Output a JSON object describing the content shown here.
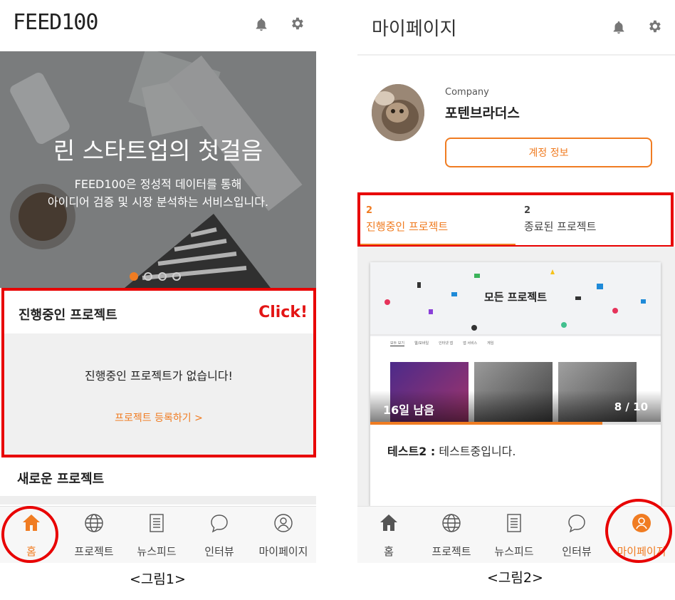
{
  "screen1": {
    "logo": "FEED100",
    "hero": {
      "title": "린 스타트업의 첫걸음",
      "subtitle_line1": "FEED100은 정성적 데이터를 통해",
      "subtitle_line2": "아이디어 검증 및 시장 분석하는 서비스입니다.",
      "slides": 4,
      "active_slide": 1
    },
    "in_progress": {
      "title": "진행중인 프로젝트",
      "annotation": "Click!",
      "empty_message": "진행중인 프로젝트가 없습니다!",
      "register_link": "프로젝트 등록하기 >"
    },
    "new_projects_title": "새로운 프로젝트",
    "nav": [
      {
        "label": "홈",
        "icon": "home-icon",
        "active": true
      },
      {
        "label": "프로젝트",
        "icon": "globe-icon",
        "active": false
      },
      {
        "label": "뉴스피드",
        "icon": "document-icon",
        "active": false
      },
      {
        "label": "인터뷰",
        "icon": "chat-bubble-icon",
        "active": false
      },
      {
        "label": "마이페이지",
        "icon": "user-icon",
        "active": false
      }
    ],
    "caption": "<그림1>"
  },
  "screen2": {
    "title": "마이페이지",
    "profile": {
      "company_label": "Company",
      "company_name": "포텐브라더스",
      "account_button": "계정 정보"
    },
    "tabs": [
      {
        "count": "2",
        "label": "진행중인 프로젝트",
        "active": true
      },
      {
        "count": "2",
        "label": "종료된 프로젝트",
        "active": false
      }
    ],
    "project_card": {
      "thumb_title": "모든 프로젝트",
      "mini_tabs": [
        "모두 보기",
        "웹/모바일",
        "인터넷 앱",
        "앱 서비스",
        "게임"
      ],
      "remaining": "16일 남음",
      "participants": "8 / 10",
      "progress": 0.8,
      "name": "테스트2 :",
      "description": "테스트중입니다."
    },
    "nav": [
      {
        "label": "홈",
        "icon": "home-icon",
        "active": false
      },
      {
        "label": "프로젝트",
        "icon": "globe-icon",
        "active": false
      },
      {
        "label": "뉴스피드",
        "icon": "document-icon",
        "active": false
      },
      {
        "label": "인터뷰",
        "icon": "chat-bubble-icon",
        "active": false
      },
      {
        "label": "마이페이지",
        "icon": "user-icon",
        "active": true
      }
    ],
    "caption": "<그림2>"
  },
  "colors": {
    "accent": "#f07c22",
    "annotation_red": "#e80000"
  }
}
